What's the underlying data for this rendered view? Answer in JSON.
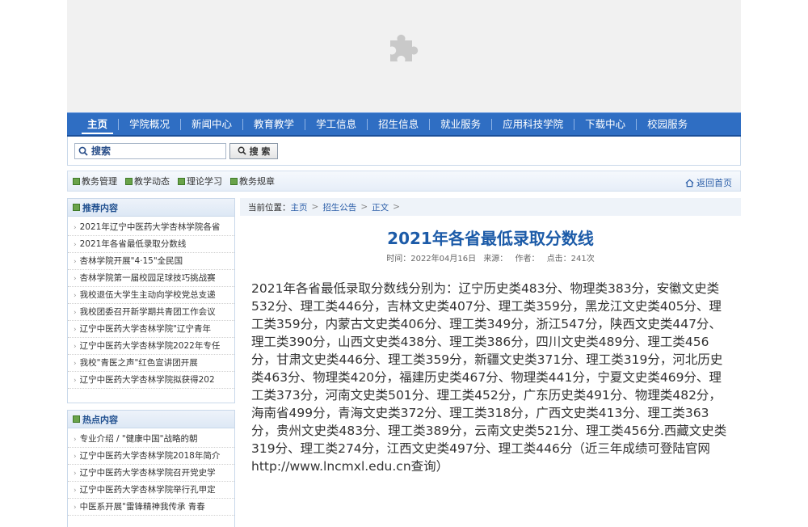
{
  "nav": [
    "主页",
    "学院概况",
    "新闻中心",
    "教育教学",
    "学工信息",
    "招生信息",
    "就业服务",
    "应用科技学院",
    "下载中心",
    "校园服务"
  ],
  "search": {
    "placeholder": "搜索",
    "button": "搜 索"
  },
  "subnav": {
    "items": [
      "教务管理",
      "教学动态",
      "理论学习",
      "教务规章"
    ],
    "home": "返回首页"
  },
  "recommended": {
    "title": "推荐内容",
    "items": [
      "2021年辽宁中医药大学杏林学院各省",
      "2021年各省最低录取分数线",
      "杏林学院开展\"4·15\"全民国",
      "杏林学院第一届校园足球技巧挑战赛",
      "我校退伍大学生主动向学校党总支递",
      "我校团委召开新学期共青团工作会议",
      "辽宁中医药大学杏林学院\"辽宁青年",
      "辽宁中医药大学杏林学院2022年专任",
      "我校\"青医之声\"红色宣讲团开展",
      "辽宁中医药大学杏林学院拟获得202"
    ]
  },
  "hot": {
    "title": "热点内容",
    "items": [
      "专业介绍 / \"健康中国\"战略的朝",
      "辽宁中医药大学杏林学院2018年简介",
      "辽宁中医药大学杏林学院召开党史学",
      "辽宁中医药大学杏林学院举行孔甲定",
      "中医系开展\"雷锋精神我传承 青春"
    ]
  },
  "breadcrumb": {
    "prefix": "当前位置：",
    "home": "主页",
    "section": "招生公告",
    "current": "正文"
  },
  "article": {
    "title": "2021年各省最低录取分数线",
    "time_label": "时间：2022年04月16日",
    "source_label": "来源：",
    "author_label": "作者：",
    "hits_label": "点击：241次",
    "body": "2021年各省最低录取分数线分别为：辽宁历史类483分、物理类383分，安徽文史类532分、理工类446分，吉林文史类407分、理工类359分，黑龙江文史类405分、理工类359分，内蒙古文史类406分、理工类349分，浙江547分，陕西文史类447分、理工类390分，山西文史类438分、理工类386分，四川文史类489分、理工类456分，甘肃文史类446分、理工类359分，新疆文史类371分、理工类319分，河北历史类463分、物理类420分，福建历史类467分、物理类441分，宁夏文史类469分、理工类373分，河南文史类501分、理工类452分，广东历史类491分、物理类482分，海南省499分，青海文史类372分、理工类318分，广西文史类413分、理工类363分，贵州文史类483分、理工类389分，云南文史类521分、理工类456分.西藏文史类319分、理工类274分，江西文史类497分、理工类446分（近三年成绩可登陆官网http://www.lncmxl.edu.cn查询）"
  },
  "colors": {
    "nav": "#2f6ec3",
    "title": "#1c5ba8",
    "accent_green": "#6aa34a"
  },
  "icons": {
    "banner": "puzzle-piece-icon",
    "search": "magnifier-icon",
    "home": "home-icon"
  }
}
